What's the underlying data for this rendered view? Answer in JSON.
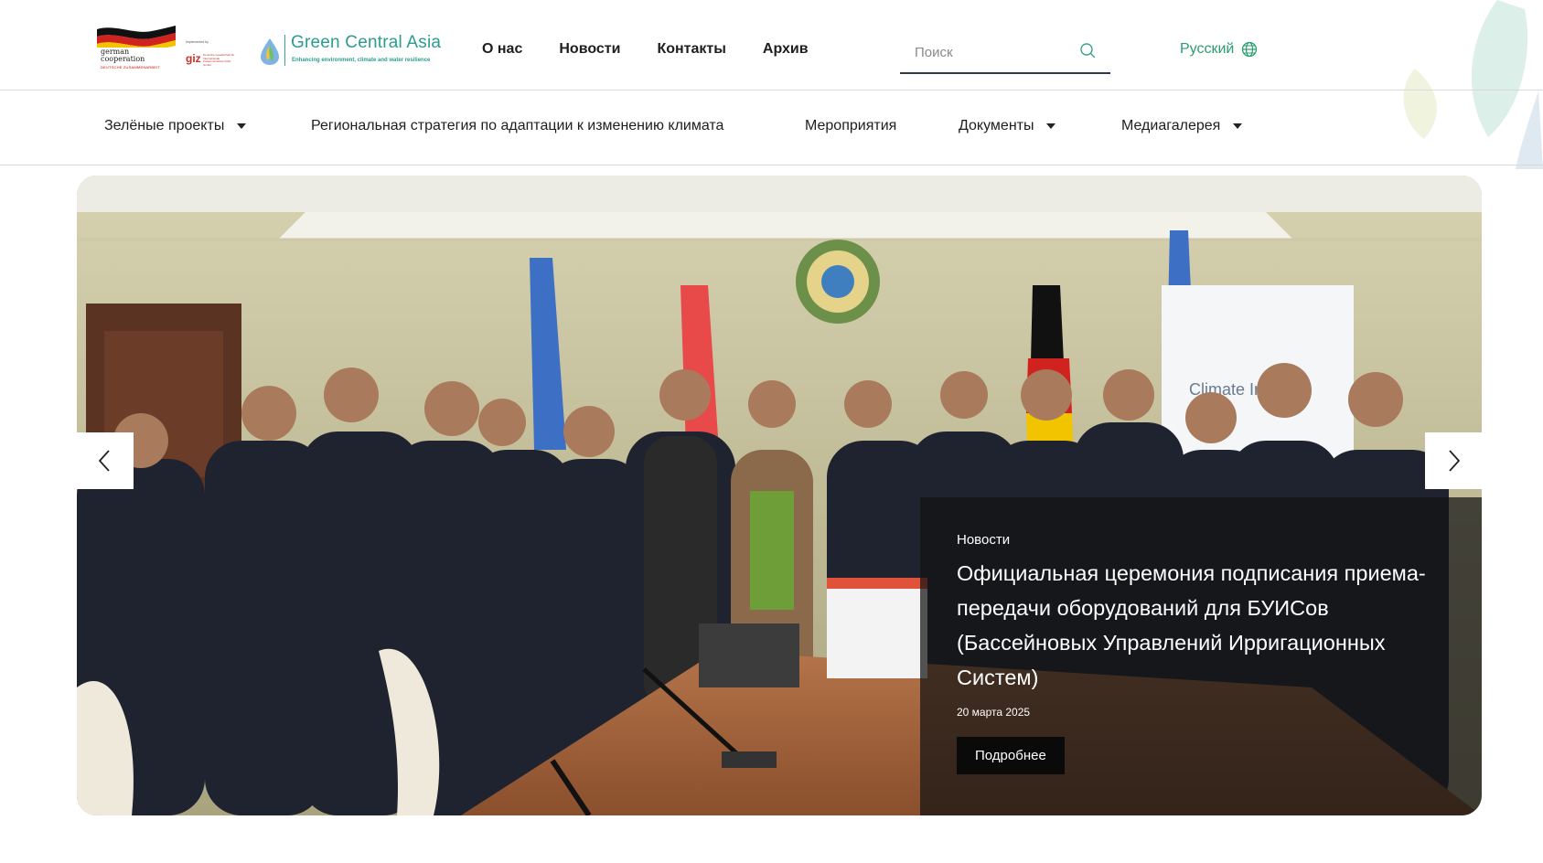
{
  "header": {
    "logos": {
      "german_cooperation": {
        "line1": "german",
        "line2": "cooperation",
        "sub": "DEUTSCHE ZUSAMMENARBEIT"
      },
      "giz": {
        "implemented_by": "Implemented by",
        "name": "giz",
        "full": "Deutsche Gesellschaft für Internationale Zusammenarbeit (GIZ) GmbH"
      },
      "green_central_asia": {
        "name": "Green Central Asia",
        "tagline": "Enhancing environment, climate and water resilience"
      }
    },
    "nav": [
      {
        "label": "О нас"
      },
      {
        "label": "Новости"
      },
      {
        "label": "Контакты"
      },
      {
        "label": "Архив"
      }
    ],
    "search": {
      "placeholder": "Поиск",
      "value": ""
    },
    "language": {
      "label": "Русский"
    }
  },
  "main_nav": [
    {
      "label": "Зелёные проекты",
      "has_dropdown": true
    },
    {
      "label": "Региональная стратегия по адаптации к изменению климата",
      "has_dropdown": false
    },
    {
      "label": "Мероприятия",
      "has_dropdown": false
    },
    {
      "label": "Документы",
      "has_dropdown": true
    },
    {
      "label": "Медиагалерея",
      "has_dropdown": true
    }
  ],
  "hero": {
    "category": "Новости",
    "title": "Официальная церемония подписания приема-передачи оборудований для БУИСов (Бассейновых Управлений Ирригационных Систем)",
    "date": "20 марта 2025",
    "button": "Подробнее",
    "banner_text": "Climate Initiative"
  },
  "colors": {
    "accent_green": "#2a9d8f",
    "language_green": "#2a9d6f",
    "caption_bg": "rgba(20,20,20,0.72)",
    "button_bg": "#0a0a0a"
  },
  "icons": {
    "search": "search-icon",
    "globe": "globe-icon",
    "prev": "chevron-left-icon",
    "next": "chevron-right-icon",
    "dropdown": "caret-down-icon"
  }
}
